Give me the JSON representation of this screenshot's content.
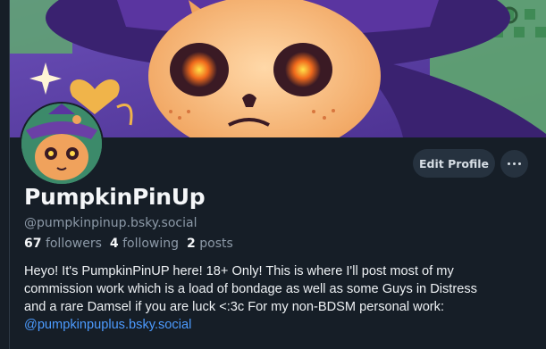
{
  "profile": {
    "display_name": "PumpkinPinUp",
    "handle": "@pumpkinpinup.bsky.social",
    "stats": {
      "followers_count": "67",
      "followers_label": "followers",
      "following_count": "4",
      "following_label": "following",
      "posts_count": "2",
      "posts_label": "posts"
    },
    "bio": {
      "line1": "Heyo! It's PumpkinPinUP here! 18+ Only! This is where I'll post most of my",
      "line2": "commission work which is a load of bondage as well as some Guys in Distress",
      "line3": "and a rare Damsel if you are luck <:3c  For my non-BDSM personal work:",
      "link": "@pumpkinpuplus.bsky.social"
    }
  },
  "actions": {
    "edit_profile_label": "Edit Profile",
    "more_icon": "ellipsis-icon"
  },
  "colors": {
    "background": "#161e27",
    "button_bg": "#26323f",
    "link": "#4c9bff",
    "banner_purple": "#6b3fa6",
    "pumpkin_orange": "#f0a25c"
  }
}
